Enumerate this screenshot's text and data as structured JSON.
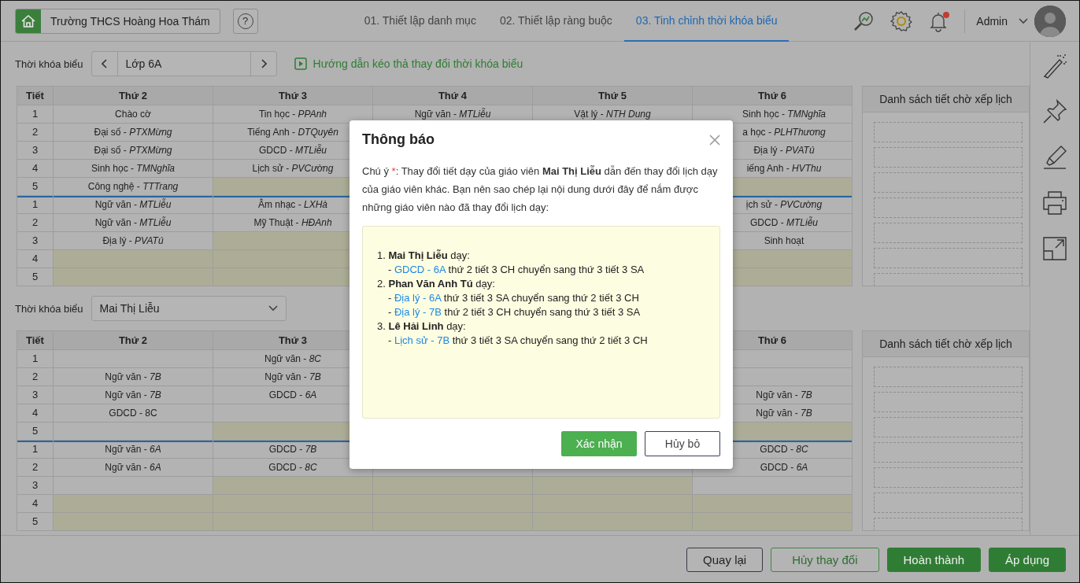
{
  "top_bar": {
    "school": "Trường THCS Hoàng Hoa Thám",
    "help": "?",
    "tabs": [
      {
        "label": "01. Thiết lập danh mục",
        "selected": false
      },
      {
        "label": "02. Thiết lập ràng buộc",
        "selected": false
      },
      {
        "label": "03. Tinh chỉnh thời khóa biểu",
        "selected": true
      }
    ],
    "has_notification": true,
    "user": "Admin"
  },
  "class_bar": {
    "label": "Thời khóa biểu",
    "value": "Lớp 6A",
    "guide_link": "Hướng dẫn kéo thả thay đổi thời khóa biểu"
  },
  "class_timetable": {
    "columns": [
      "Tiết",
      "Thứ 2",
      "Thứ 3",
      "Thứ 4",
      "Thứ 5",
      "Thứ 6"
    ],
    "pending_title": "Danh sách tiết chờ xếp lịch",
    "sessions": [
      {
        "rows": [
          {
            "period": "1",
            "cells": [
              {
                "text": "Chào cờ",
                "free": false
              },
              {
                "text": "Tin học - *PPAnh*",
                "free": false
              },
              {
                "text": "Ngữ văn - *MTLiễu*",
                "free": false
              },
              {
                "text": "Vật lý - *NTH Dung*",
                "free": false
              },
              {
                "text": "Sinh học - *TMNghĩa*",
                "free": false
              }
            ]
          },
          {
            "period": "2",
            "cells": [
              {
                "text": "Đại số - *PTXMừng*",
                "free": false
              },
              {
                "text": "Tiếng Anh - *DTQuyên*",
                "free": false
              },
              {},
              {},
              {
                "text": "a học - *PLHThương*",
                "free": false
              }
            ]
          },
          {
            "period": "3",
            "cells": [
              {
                "text": "Đại số - *PTXMừng*",
                "free": false
              },
              {
                "text": "GDCD - *MTLiễu*",
                "free": false
              },
              {},
              {},
              {
                "text": "Địa lý - *PVATú*",
                "free": false
              }
            ]
          },
          {
            "period": "4",
            "cells": [
              {
                "text": "Sinh học - *TMNghĩa*",
                "free": false
              },
              {
                "text": "Lịch sử - *PVCường*",
                "free": false
              },
              {},
              {},
              {
                "text": "iếng Anh - *HVThu*",
                "free": false
              }
            ]
          },
          {
            "period": "5",
            "cells": [
              {
                "text": "Công nghệ - *TTTrang*",
                "free": false
              },
              {
                "free": true
              },
              {},
              {},
              {
                "free": true
              }
            ]
          }
        ]
      },
      {
        "rows": [
          {
            "period": "1",
            "cells": [
              {
                "text": "Ngữ văn - *MTLiễu*",
                "free": false
              },
              {
                "text": "Âm nhạc - *LXHà*",
                "free": false
              },
              {},
              {},
              {
                "text": "ịch sử - *PVCường*",
                "free": false
              }
            ]
          },
          {
            "period": "2",
            "cells": [
              {
                "text": "Ngữ văn - *MTLiễu*",
                "free": false
              },
              {
                "text": "Mỹ Thuật - *HĐAnh*",
                "free": false
              },
              {},
              {},
              {
                "text": "GDCD - *MTLiễu*",
                "free": false
              }
            ]
          },
          {
            "period": "3",
            "cells": [
              {
                "text": "Địa lý - *PVATú*",
                "free": false
              },
              {
                "free": true
              },
              {},
              {},
              {
                "text": "Sinh hoạt",
                "free": false
              }
            ]
          },
          {
            "period": "4",
            "cells": [
              {
                "free": true
              },
              {
                "free": true
              },
              {},
              {},
              {
                "free": true
              }
            ]
          },
          {
            "period": "5",
            "cells": [
              {
                "free": true
              },
              {
                "free": true
              },
              {},
              {},
              {
                "free": true
              }
            ]
          }
        ]
      }
    ]
  },
  "teacher_bar": {
    "label": "Thời khóa biểu",
    "teacher": "Mai Thị Liễu"
  },
  "teacher_timetable": {
    "columns": [
      "Tiết",
      "Thứ 2",
      "Thứ 3",
      "",
      "",
      "Thứ 6"
    ],
    "pending_title": "Danh sách tiết chờ xếp lịch",
    "sessions": [
      {
        "rows": [
          {
            "period": "1",
            "cells": [
              {
                "free": false
              },
              {
                "text": "Ngữ văn - *8C*",
                "free": false
              },
              {},
              {},
              {
                "free": false
              }
            ]
          },
          {
            "period": "2",
            "cells": [
              {
                "text": "Ngữ văn - *7B*",
                "free": false
              },
              {
                "text": "Ngữ văn - *7B*",
                "free": false
              },
              {},
              {},
              {
                "free": false
              }
            ]
          },
          {
            "period": "3",
            "cells": [
              {
                "text": "Ngữ văn - *7B*",
                "free": false
              },
              {
                "text": "GDCD - *6A*",
                "free": false
              },
              {},
              {},
              {
                "text": "Ngữ văn - *7B*",
                "free": false
              }
            ]
          },
          {
            "period": "4",
            "cells": [
              {
                "text": "GDCD - 8C",
                "free": false
              },
              {
                "free": false
              },
              {},
              {},
              {
                "text": "Ngữ văn - *7B*",
                "free": false
              }
            ]
          },
          {
            "period": "5",
            "cells": [
              {
                "free": false
              },
              {
                "free": true
              },
              {},
              {},
              {
                "free": true
              }
            ]
          }
        ]
      },
      {
        "rows": [
          {
            "period": "1",
            "cells": [
              {
                "text": "Ngữ văn - *6A*",
                "free": false
              },
              {
                "text": "GDCD - *7B*",
                "free": false
              },
              {},
              {},
              {
                "text": "GDCD - *8C*",
                "free": false
              }
            ]
          },
          {
            "period": "2",
            "cells": [
              {
                "text": "Ngữ văn - *6A*",
                "free": false
              },
              {
                "text": "GDCD - *8C*",
                "free": false
              },
              {},
              {},
              {
                "text": "GDCD - *6A*",
                "free": false
              }
            ]
          },
          {
            "period": "3",
            "cells": [
              {
                "free": false
              },
              {
                "free": true
              },
              {
                "free": true
              },
              {
                "free": true
              },
              {
                "free": false
              }
            ]
          },
          {
            "period": "4",
            "cells": [
              {
                "free": true
              },
              {
                "free": true
              },
              {
                "free": true
              },
              {
                "free": true
              },
              {
                "free": true
              }
            ]
          },
          {
            "period": "5",
            "cells": [
              {
                "free": true
              },
              {
                "free": true
              },
              {
                "free": true
              },
              {
                "free": true
              },
              {
                "free": true
              }
            ]
          }
        ]
      }
    ]
  },
  "dialog": {
    "title": "Thông báo",
    "note_label": "Chú ý",
    "required_mark": "*",
    "text": ": Thay đổi tiết dạy của giáo viên **Mai Thị Liễu** dẫn đến thay đổi lịch dạy của giáo viên khác. Bạn nên sao chép lại nội dung dưới đây để nắm được những giáo viên nào đã thay đổi lịch dạy:",
    "changes": [
      {
        "heading": "1. **Mai Thị Liễu** dạy:",
        "lines": [
          {
            "dash": "-",
            "link": "GDCD - 6A",
            "text": "thứ 2 tiết 3 CH chuyển sang thứ 3 tiết 3 SA"
          }
        ]
      },
      {
        "heading": "2. **Phan Văn Anh Tú** dạy:",
        "lines": [
          {
            "dash": "-",
            "link": "Địa lý - 6A",
            "text": "thứ 3 tiết 3 SA chuyển sang thứ 2 tiết 3 CH"
          },
          {
            "dash": "-",
            "link": "Địa lý - 7B",
            "text": "thứ 2 tiết 3 CH chuyển sang thứ 3 tiết 3 SA"
          }
        ]
      },
      {
        "heading": "3. **Lê Hải Linh** dạy:",
        "lines": [
          {
            "dash": "-",
            "link": "Lịch sử - 7B",
            "text": "thứ 3 tiết 3 SA chuyển sang thứ 2 tiết 3 CH"
          }
        ]
      }
    ],
    "buttons": [
      {
        "label": "Xác nhận",
        "kind": "primary"
      },
      {
        "label": "Hủy bỏ",
        "kind": "secondary"
      }
    ]
  },
  "footer_buttons": [
    {
      "label": "Quay lại",
      "kind": "outline"
    },
    {
      "label": "Hủy thay đổi",
      "kind": "outline-green"
    },
    {
      "label": "Hoàn thành",
      "kind": "primary"
    },
    {
      "label": "Áp dụng",
      "kind": "primary"
    }
  ]
}
